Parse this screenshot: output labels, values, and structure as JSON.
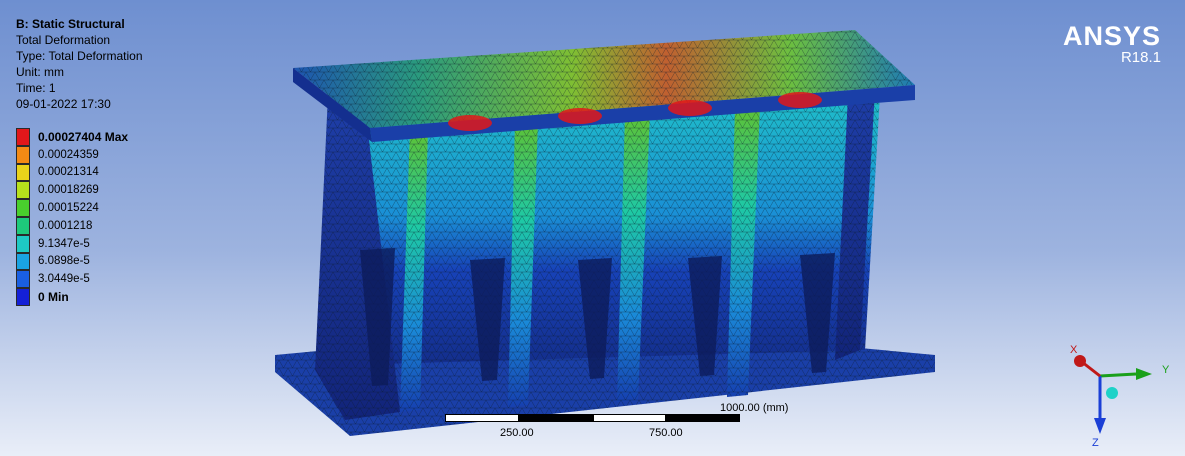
{
  "info": {
    "title": "B: Static Structural",
    "lines": [
      "Total Deformation",
      "Type: Total Deformation",
      "Unit: mm",
      "Time: 1",
      "09-01-2022 17:30"
    ]
  },
  "legend": {
    "entries": [
      {
        "label": "0.00027404 Max",
        "color": "#e2171a",
        "bold": true
      },
      {
        "label": "0.00024359",
        "color": "#f48a14",
        "bold": false
      },
      {
        "label": "0.00021314",
        "color": "#e9d31a",
        "bold": false
      },
      {
        "label": "0.00018269",
        "color": "#b7e21c",
        "bold": false
      },
      {
        "label": "0.00015224",
        "color": "#49cf2d",
        "bold": false
      },
      {
        "label": "0.0001218",
        "color": "#1ec97b",
        "bold": false
      },
      {
        "label": "9.1347e-5",
        "color": "#1ec9c3",
        "bold": false
      },
      {
        "label": "6.0898e-5",
        "color": "#1aa3e2",
        "bold": false
      },
      {
        "label": "3.0449e-5",
        "color": "#1a5fe2",
        "bold": false
      },
      {
        "label": "0 Min",
        "color": "#1420d6",
        "bold": true
      }
    ]
  },
  "brand": {
    "name": "ANSYS",
    "version": "R18.1"
  },
  "scale": {
    "total": "1000.00 (mm)",
    "mid1": "250.00",
    "mid2": "750.00"
  },
  "triad": {
    "x": "X",
    "y": "Y",
    "z": "Z"
  }
}
